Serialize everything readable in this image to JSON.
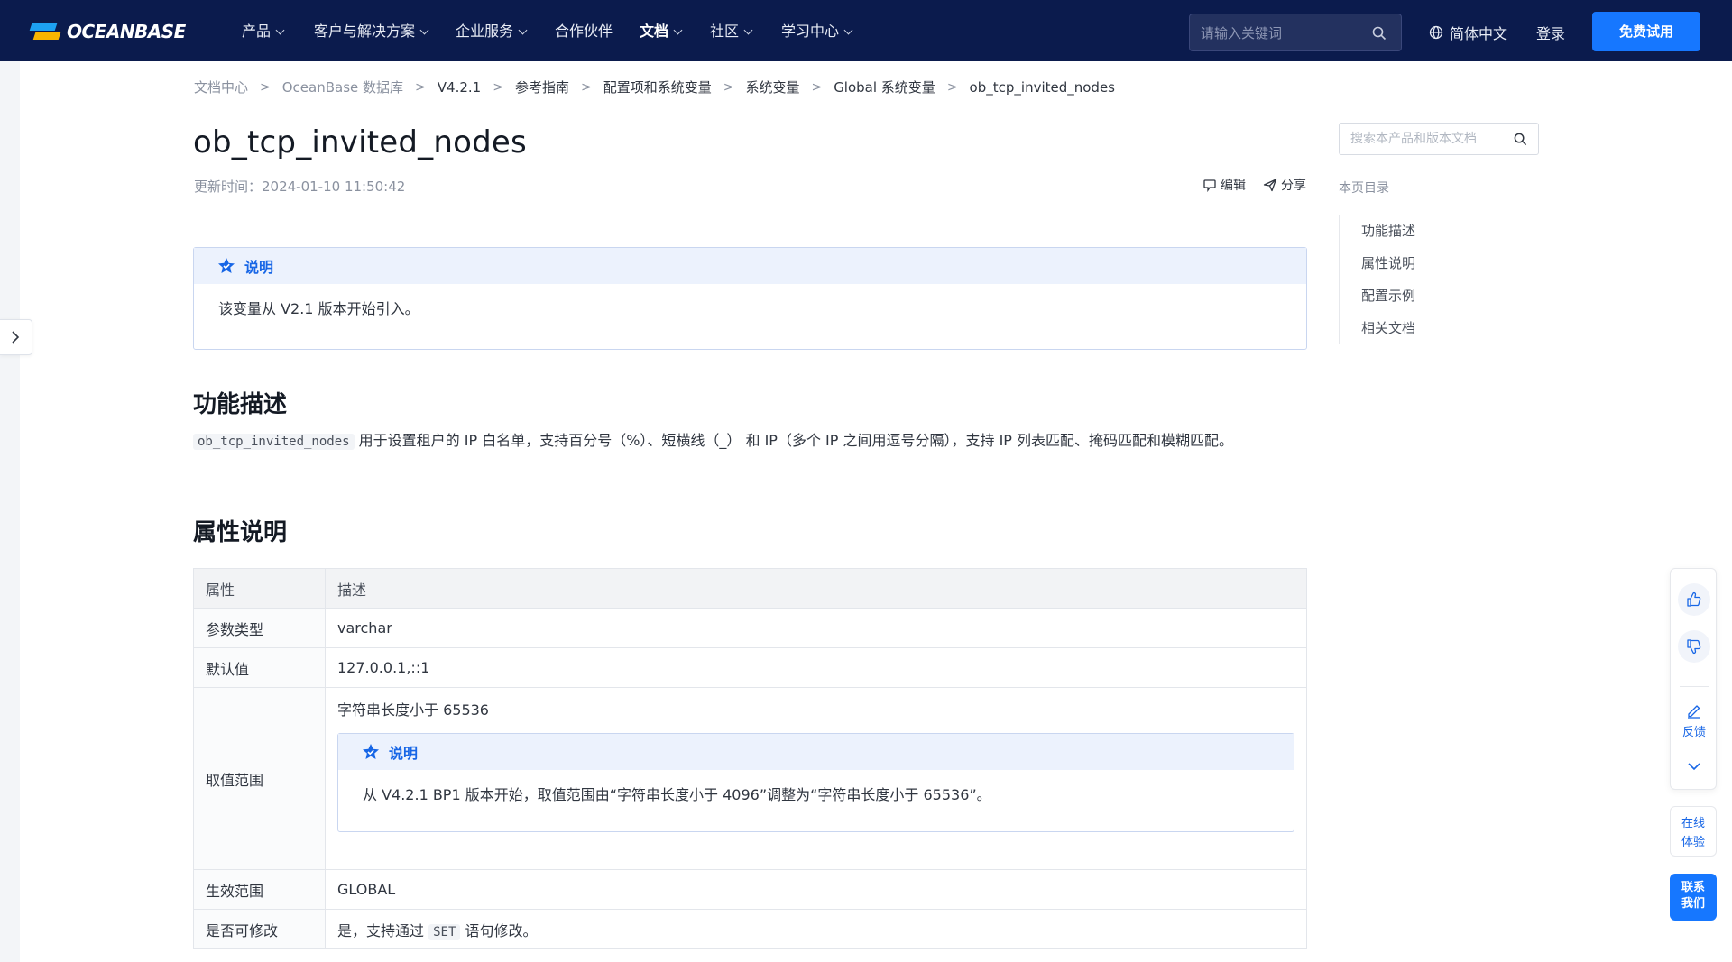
{
  "nav": {
    "logo_text": "OCEANBASE",
    "items": [
      {
        "label": "产品",
        "has_dropdown": true
      },
      {
        "label": "客户与解决方案",
        "has_dropdown": true
      },
      {
        "label": "企业服务",
        "has_dropdown": true
      },
      {
        "label": "合作伙伴",
        "has_dropdown": false
      },
      {
        "label": "文档",
        "has_dropdown": true
      },
      {
        "label": "社区",
        "has_dropdown": true
      },
      {
        "label": "学习中心",
        "has_dropdown": true
      }
    ],
    "search_placeholder": "请输入关键词",
    "language": "简体中文",
    "login": "登录",
    "trial_button": "免费试用",
    "colors": {
      "background": "#0b1b4d",
      "accent": "#1677ff"
    }
  },
  "breadcrumb": [
    "文档中心",
    "OceanBase 数据库",
    "V4.2.1",
    "参考指南",
    "配置项和系统变量",
    "系统变量",
    "Global 系统变量",
    "ob_tcp_invited_nodes"
  ],
  "page": {
    "title": "ob_tcp_invited_nodes",
    "update_time": "更新时间：2024-01-10 11:50:42",
    "edit_label": "编辑",
    "share_label": "分享"
  },
  "note_top": {
    "heading": "说明",
    "text": "该变量从 V2.1 版本开始引入。"
  },
  "section_function": {
    "heading": "功能描述",
    "code": "ob_tcp_invited_nodes",
    "text": "用于设置租户的 IP 白名单，支持百分号（%）、短横线（_） 和 IP（多个 IP 之间用逗号分隔），支持 IP 列表匹配、掩码匹配和模糊匹配。"
  },
  "section_props": {
    "heading": "属性说明",
    "col_attr": "属性",
    "col_desc": "描述",
    "rows": [
      {
        "key": "参数类型",
        "value": "varchar"
      },
      {
        "key": "默认值",
        "value": "127.0.0.1,::1"
      },
      {
        "key": "取值范围",
        "value": "字符串长度小于 65536"
      },
      {
        "key": "生效范围",
        "value": "GLOBAL"
      },
      {
        "key": "是否可修改",
        "value_prefix": "是，支持通过",
        "value_code": "SET",
        "value_suffix": "语句修改。"
      }
    ],
    "range_note": {
      "heading": "说明",
      "text": "从 V4.2.1 BP1 版本开始，取值范围由“字符串长度小于 4096”调整为“字符串长度小于 65536”。"
    }
  },
  "sidebar": {
    "search_placeholder": "搜索本产品和版本文档",
    "toc_title": "本页目录",
    "toc": [
      "功能描述",
      "属性说明",
      "配置示例",
      "相关文档"
    ]
  },
  "widgets": {
    "feedback_label": "反馈",
    "trial_line1": "在线",
    "trial_line2": "体验",
    "contact_line1": "联系",
    "contact_line2": "我们"
  },
  "icons": {
    "search": "search-icon",
    "globe": "globe-icon",
    "note": "star-badge-icon",
    "edit": "github-icon",
    "share": "send-icon",
    "like": "thumbs-up-icon",
    "dislike": "thumbs-down-icon",
    "feedback": "pencil-icon",
    "collapse": "chevron-down-icon",
    "sidebar_toggle": "chevron-right-icon"
  }
}
